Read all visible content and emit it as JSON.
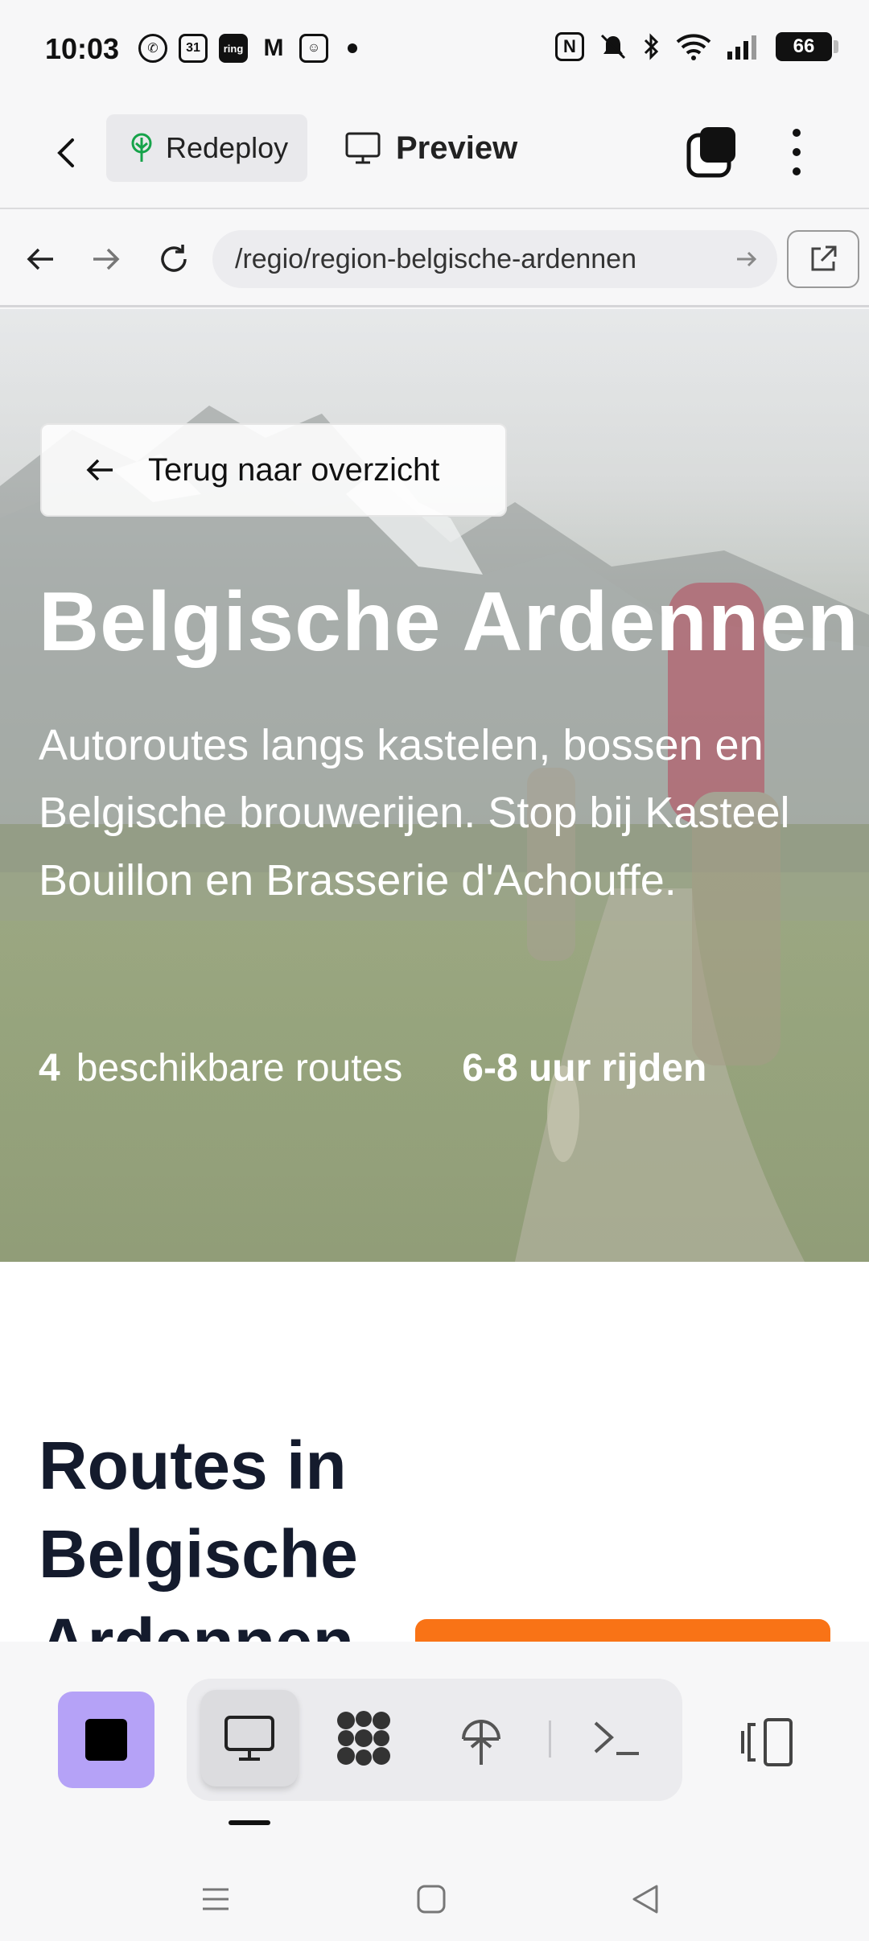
{
  "status_bar": {
    "time": "10:03",
    "notification_icons": [
      "whatsapp-icon",
      "calendar-icon",
      "ring-icon",
      "gmail-icon",
      "assistant-icon"
    ],
    "calendar_day": "31",
    "ring_label": "ring",
    "battery": "66"
  },
  "app_bar": {
    "redeploy_label": "Redeploy",
    "preview_label": "Preview"
  },
  "url_bar": {
    "url": "/regio/region-belgische-ardennen"
  },
  "hero": {
    "back_label": "Terug naar overzicht",
    "title": "Belgische Ardennen",
    "description": "Autoroutes langs kastelen, bossen en Belgische brouwerijen. Stop bij Kasteel Bouillon en Brasserie d'Achouffe.",
    "route_count": "4",
    "route_count_label": "beschikbare routes",
    "duration": "6-8 uur rijden"
  },
  "section": {
    "title": "Routes in Belgische Ardennen"
  },
  "colors": {
    "accent_orange": "#f97316",
    "stop_button": "#b5a2f7",
    "title_dark": "#141b2d"
  },
  "toolbar": {
    "items": [
      "stop-button",
      "preview-icon",
      "apps-icon",
      "deploy-icon",
      "terminal-icon",
      "device-toggle-icon"
    ],
    "active": "preview-icon"
  }
}
